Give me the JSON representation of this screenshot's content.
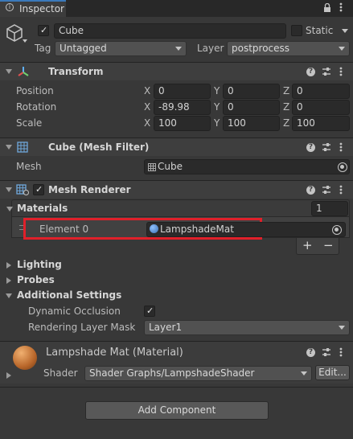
{
  "tab": {
    "label": "Inspector"
  },
  "object": {
    "name": "Cube",
    "static_label": "Static",
    "tag_label": "Tag",
    "tag_value": "Untagged",
    "layer_label": "Layer",
    "layer_value": "postprocess"
  },
  "transform": {
    "title": "Transform",
    "position": {
      "label": "Position",
      "x": "0",
      "y": "0",
      "z": "0"
    },
    "rotation": {
      "label": "Rotation",
      "x": "-89.98",
      "y": "0",
      "z": "0"
    },
    "scale": {
      "label": "Scale",
      "x": "100",
      "y": "100",
      "z": "100"
    },
    "axis": {
      "x": "X",
      "y": "Y",
      "z": "Z"
    }
  },
  "mesh_filter": {
    "title": "Cube (Mesh Filter)",
    "mesh_label": "Mesh",
    "mesh_value": "Cube"
  },
  "mesh_renderer": {
    "title": "Mesh Renderer",
    "materials_label": "Materials",
    "materials_count": "1",
    "element_label": "Element 0",
    "element_value": "LampshadeMat",
    "plus": "+",
    "minus": "−",
    "lighting": "Lighting",
    "probes": "Probes",
    "additional_settings": "Additional Settings",
    "dynamic_occlusion_label": "Dynamic Occlusion",
    "rendering_layer_label": "Rendering Layer Mask",
    "rendering_layer_value": "Layer1"
  },
  "material": {
    "title": "Lampshade Mat (Material)",
    "shader_label": "Shader",
    "shader_value": "Shader Graphs/LampshadeShader",
    "edit_label": "Edit..."
  },
  "add_component": {
    "label": "Add Component"
  },
  "colors": {
    "highlight": "#e0202a",
    "tab_accent": "#3a79bb",
    "bg": "#383838"
  }
}
